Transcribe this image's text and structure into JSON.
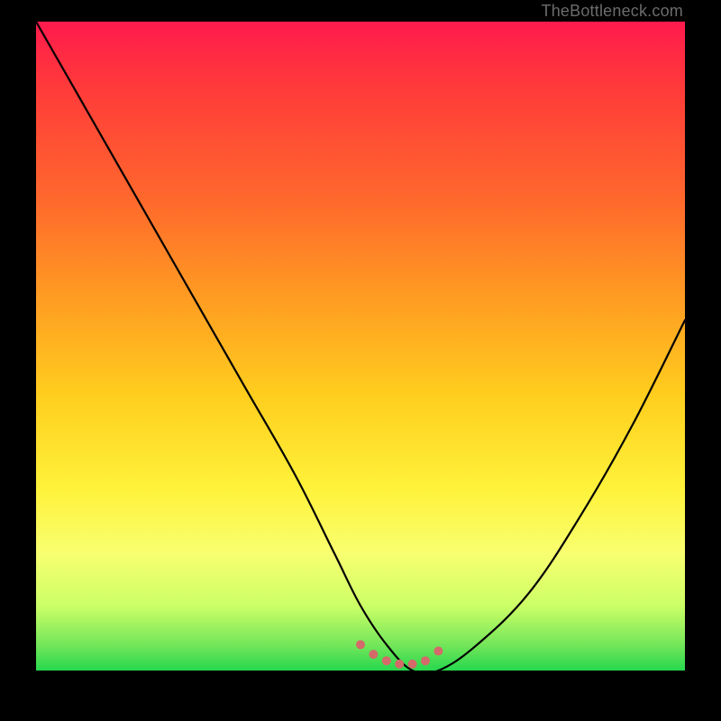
{
  "credit": "TheBottleneck.com",
  "chart_data": {
    "type": "line",
    "title": "",
    "xlabel": "",
    "ylabel": "",
    "xlim": [
      0,
      100
    ],
    "ylim": [
      0,
      100
    ],
    "series": [
      {
        "name": "curve",
        "x": [
          0,
          8,
          16,
          24,
          32,
          40,
          46,
          50,
          54,
          58,
          62,
          68,
          76,
          84,
          92,
          100
        ],
        "values": [
          100,
          86,
          72,
          58,
          44,
          30,
          18,
          10,
          4,
          0,
          0,
          4,
          12,
          24,
          38,
          54
        ]
      }
    ],
    "trough_marker": {
      "x": [
        50,
        52,
        54,
        56,
        58,
        60,
        62
      ],
      "y": [
        4,
        2.5,
        1.5,
        1,
        1,
        1.5,
        3
      ],
      "color": "#d46a6a",
      "radius": 5
    },
    "colors": {
      "curve": "#000000",
      "background_top": "#ff1a4d",
      "background_bottom": "#26d84e"
    }
  }
}
